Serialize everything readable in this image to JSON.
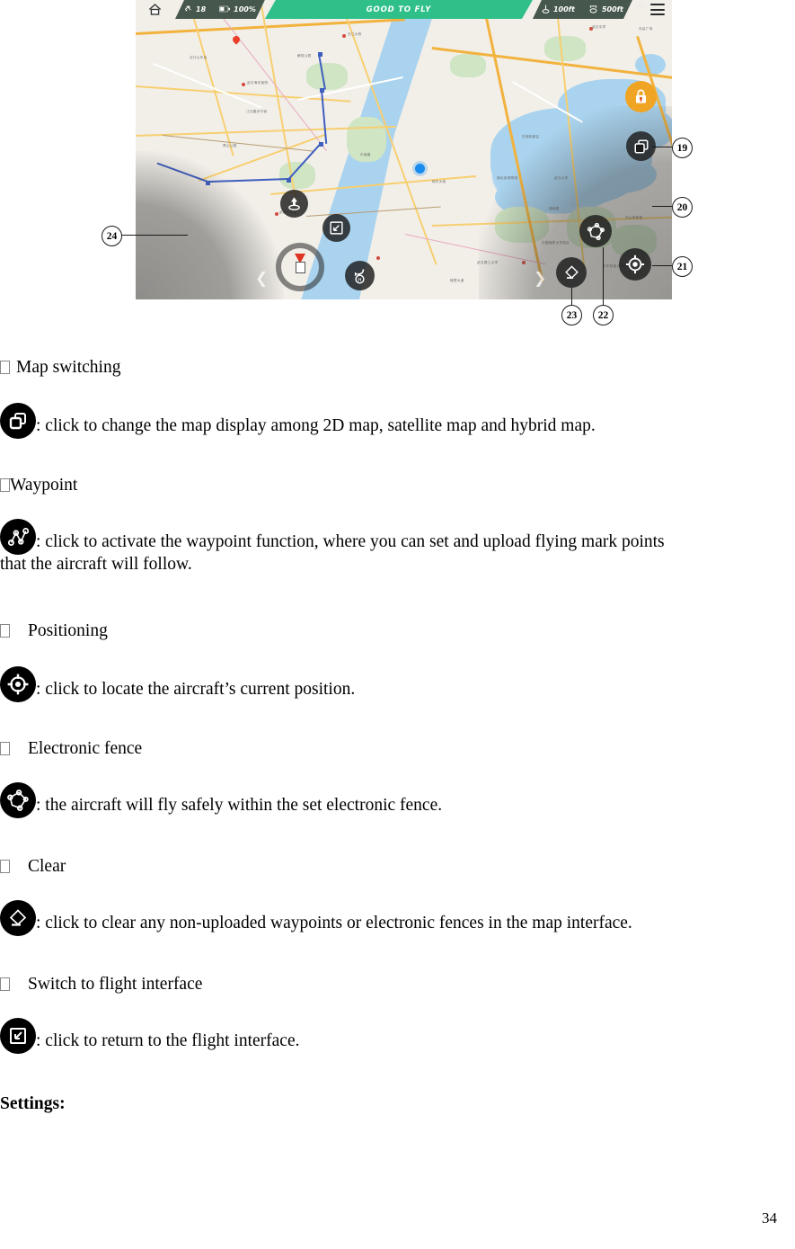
{
  "figure": {
    "status_bar": {
      "home_icon": "home-icon",
      "satellite_icon": "satellite-icon",
      "satellite_count": "18",
      "battery_icon": "battery-icon",
      "battery_level": "100%",
      "flight_status": "GOOD TO FLY",
      "altitude_icon": "altitude-icon",
      "altitude": "100ft",
      "distance_icon": "distance-icon",
      "distance": "500ft",
      "signal_small": "RTH",
      "menu_icon": "hamburger-menu-icon"
    },
    "left_controls": [
      {
        "name": "takeoff-button",
        "icon": "takeoff-arrow-icon"
      },
      {
        "name": "switch-to-flight-button",
        "icon": "expand-diagonal-icon"
      },
      {
        "name": "return-to-home-button",
        "icon": "return-home-icon"
      },
      {
        "name": "compass",
        "icon": "compass-icon"
      }
    ],
    "right_controls": [
      {
        "name": "lock-button",
        "icon": "lock-icon"
      },
      {
        "name": "map-switching-button",
        "icon": "layers-icon"
      },
      {
        "name": "waypoint-button",
        "icon": "waypoint-icon"
      },
      {
        "name": "electronic-fence-button",
        "icon": "polygon-fence-icon"
      },
      {
        "name": "positioning-button",
        "icon": "crosshair-target-icon"
      },
      {
        "name": "clear-button",
        "icon": "eraser-icon"
      }
    ],
    "callouts": [
      {
        "label": "19",
        "target": "map-switching-button"
      },
      {
        "label": "20",
        "target": "waypoint-button"
      },
      {
        "label": "21",
        "target": "positioning-button"
      },
      {
        "label": "22",
        "target": "electronic-fence-button"
      },
      {
        "label": "23",
        "target": "clear-button"
      },
      {
        "label": "24",
        "target": "switch-to-flight-button"
      }
    ],
    "map_labels": [
      "武汉海关医院",
      "长江大桥",
      "汉口火车站",
      "武昌火车站",
      "东湖风景区",
      "中国地质大学校区",
      "武汉理工大学",
      "华中科技大学附中",
      "洪山体育馆",
      "湖北省博物馆",
      "武汉大学",
      "青山公园",
      "光谷广场",
      "武汉中学",
      "江汉路步行街",
      "解放公园",
      "中南路",
      "徐东大街",
      "珞喻路",
      "雄楚大道"
    ]
  },
  "document": {
    "sections": [
      {
        "heading": "Map switching",
        "heading_prefix": "tofu-box",
        "icon": "layers-icon",
        "description": ": click to change the map display among 2D map, satellite map and hybrid map."
      },
      {
        "heading": "Waypoint",
        "heading_prefix": "tofu-box",
        "icon": "waypoint-icon",
        "description": ": click to activate the waypoint function, where you can set and upload flying mark points that the aircraft will follow."
      },
      {
        "heading": "Positioning",
        "heading_prefix": "tofu-box",
        "icon": "crosshair-target-icon",
        "description": ": click to locate the aircraft’s current position."
      },
      {
        "heading": "Electronic fence",
        "heading_prefix": "tofu-box",
        "icon": "polygon-fence-icon",
        "description": ": the aircraft will fly safely within the set electronic fence."
      },
      {
        "heading": "Clear",
        "heading_prefix": "tofu-box",
        "icon": "eraser-icon",
        "description": ": click to clear any non-uploaded waypoints or electronic fences in the map interface."
      },
      {
        "heading": "Switch to flight interface",
        "heading_prefix": "tofu-box",
        "icon": "expand-diagonal-icon",
        "description": ": click to return to the flight interface."
      }
    ],
    "waypoint_line1": ": click to activate the waypoint function, where you can set and upload flying mark points",
    "waypoint_line2": "that the aircraft will follow.",
    "settings_heading": "Settings:",
    "page_number": "34"
  }
}
